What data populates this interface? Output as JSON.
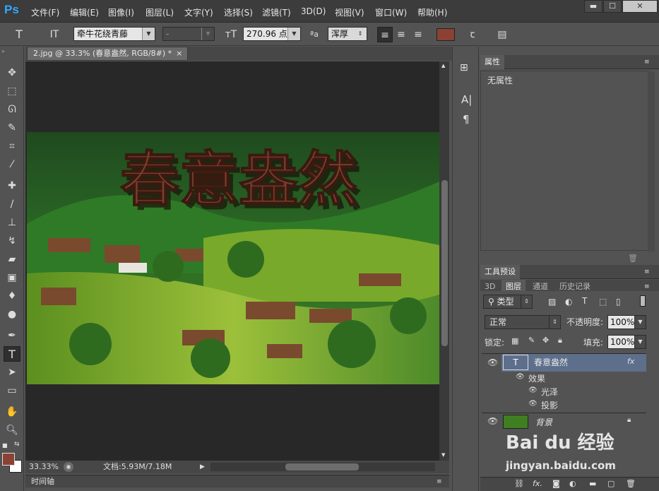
{
  "app": {
    "logo": "Ps"
  },
  "menu": [
    "文件(F)",
    "编辑(E)",
    "图像(I)",
    "图层(L)",
    "文字(Y)",
    "选择(S)",
    "滤镜(T)",
    "3D(D)",
    "视图(V)",
    "窗口(W)",
    "帮助(H)"
  ],
  "window_buttons": [
    "▬",
    "☐",
    "✕"
  ],
  "options": {
    "font_family": "牵牛花绕青藤",
    "font_style": "-",
    "font_size": "270.96 点",
    "aa_label": "ªa",
    "aa_mode": "浑厚",
    "text_color": "#8b4232"
  },
  "document": {
    "tab_title": "2.jpg @ 33.3% (春意盎然, RGB/8#) *",
    "artwork_text": "春意盎然"
  },
  "status": {
    "zoom": "33.33%",
    "doc_info": "文档:5.93M/7.18M"
  },
  "timeline": {
    "label": "时间轴"
  },
  "properties": {
    "tab": "属性",
    "empty": "无属性"
  },
  "tool_presets": {
    "tab": "工具预设"
  },
  "layers_panel": {
    "tabs": [
      "3D",
      "图层",
      "通道",
      "历史记录"
    ],
    "filter_type": "类型",
    "blend_mode": "正常",
    "opacity_label": "不透明度:",
    "opacity_value": "100%",
    "lock_label": "锁定:",
    "fill_label": "填充:",
    "fill_value": "100%",
    "layers": [
      {
        "name": "春意盎然",
        "fx": "fx",
        "thumb": "T"
      },
      {
        "name": "效果"
      },
      {
        "name": "光泽"
      },
      {
        "name": "投影"
      },
      {
        "name": "背景"
      }
    ]
  },
  "watermark": {
    "brand": "Bai  du 经验",
    "url": "jingyan.baidu.com"
  },
  "colors": {
    "accent": "#31a8ff",
    "foreground": "#8b4232",
    "background": "#ffffff",
    "active_layer": "#5e6f8c"
  }
}
